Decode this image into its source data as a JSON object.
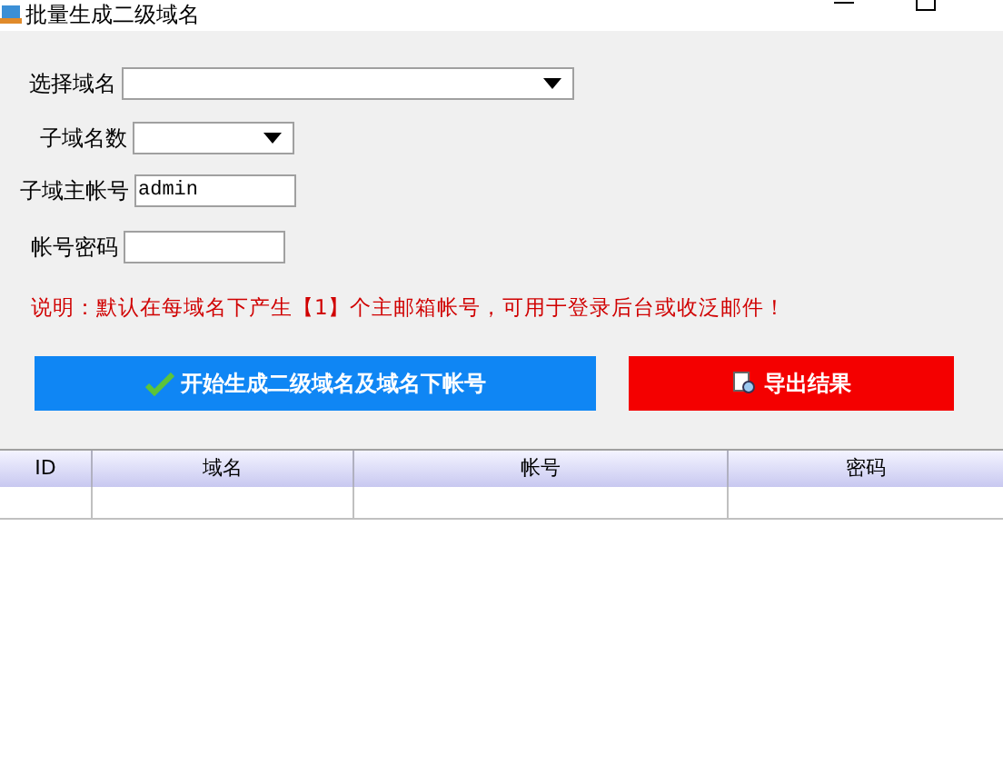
{
  "window": {
    "title": "批量生成二级域名"
  },
  "form": [
    {
      "label": "选择域名",
      "kind": "combo"
    },
    {
      "label": "子域名数",
      "kind": "combo"
    },
    {
      "label": "子域主帐号",
      "kind": "text",
      "value": "admin"
    },
    {
      "label": "帐号密码",
      "kind": "text"
    }
  ],
  "note": "说明：默认在每域名下产生【1】个主邮箱帐号，可用于登录后台或收泛邮件！",
  "buttons": [
    {
      "label": "开始生成二级域名及域名下帐号",
      "kind": "generate"
    },
    {
      "label": "导出结果",
      "kind": "export"
    }
  ],
  "table": {
    "columns": [
      "ID",
      "域名",
      "帐号",
      "密码"
    ]
  }
}
